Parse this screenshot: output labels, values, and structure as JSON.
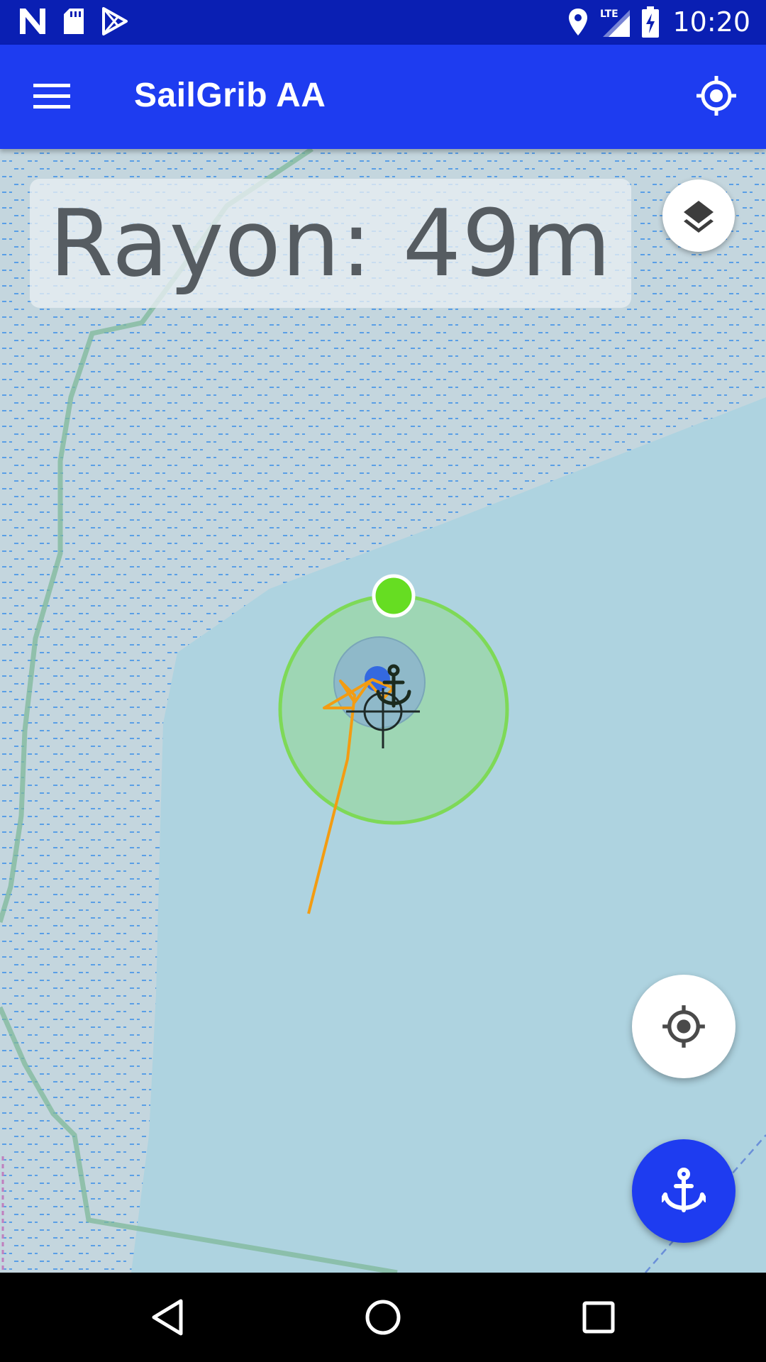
{
  "status_bar": {
    "time": "10:20",
    "network": "LTE",
    "icons": [
      "notification-n-icon",
      "sd-card-icon",
      "play-store-icon",
      "location-pin-icon",
      "signal-lte-icon",
      "battery-charging-icon"
    ]
  },
  "app_bar": {
    "title": "SailGrib AA",
    "menu_icon": "hamburger-menu-icon",
    "action_icon": "gps-locate-icon"
  },
  "map": {
    "radius_label": "Rayon: 49m",
    "layers_icon": "layers-icon",
    "colors": {
      "water": "#aed3e0",
      "shallow": "#c4d6de",
      "hatch": "#5a9fe6",
      "alarm_circle": "#7ed957",
      "track": "#f39c12",
      "brand": "#1e3cf0"
    }
  },
  "fabs": {
    "locate_icon": "gps-locate-icon",
    "anchor_icon": "anchor-icon"
  },
  "nav_bar": {
    "icons": [
      "back-triangle-icon",
      "home-circle-icon",
      "recents-square-icon"
    ]
  }
}
